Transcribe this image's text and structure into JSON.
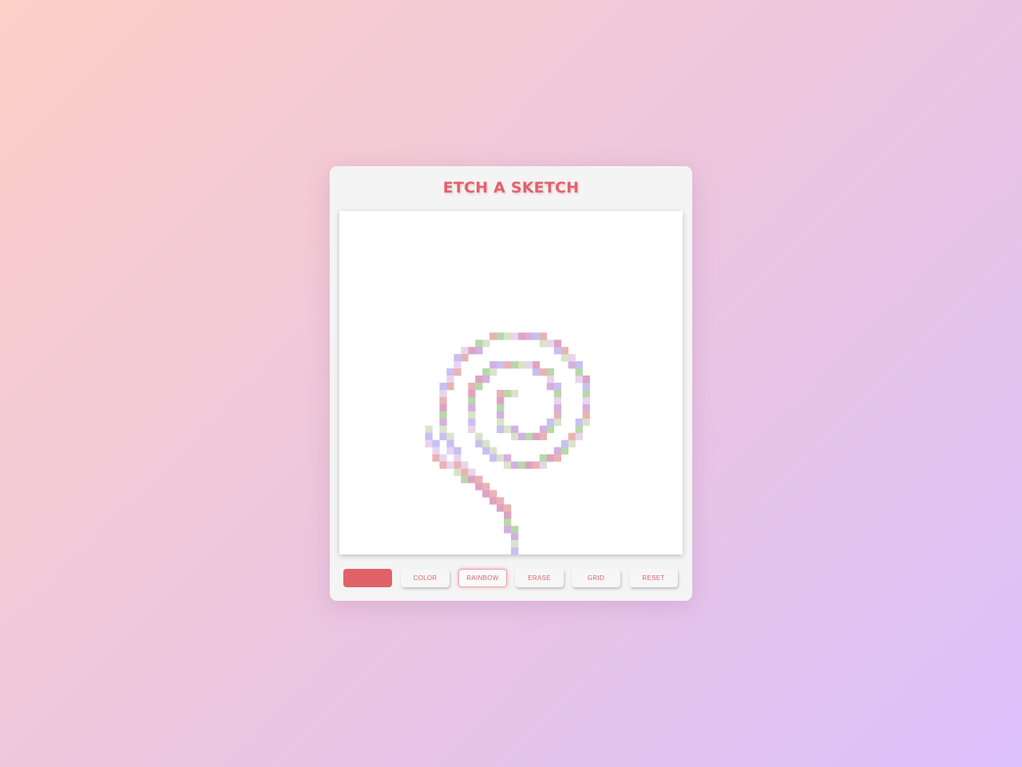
{
  "app": {
    "title": "ETCH A SKETCH",
    "accent_color": "#e2626c"
  },
  "controls": {
    "color_swatch": "#e06268",
    "buttons": [
      {
        "id": "color",
        "label": "Color",
        "active": false
      },
      {
        "id": "rainbow",
        "label": "Rainbow",
        "active": true
      },
      {
        "id": "erase",
        "label": "Erase",
        "active": false
      },
      {
        "id": "grid",
        "label": "Grid",
        "active": false
      },
      {
        "id": "reset",
        "label": "Reset",
        "active": false
      }
    ]
  },
  "sketch": {
    "grid_size": 48,
    "palette": [
      "#d4b0e0",
      "#b7d8a9",
      "#dea3c2",
      "#eab3b3",
      "#e9d4ee",
      "#c8c0f2",
      "#d9e3c9"
    ]
  }
}
